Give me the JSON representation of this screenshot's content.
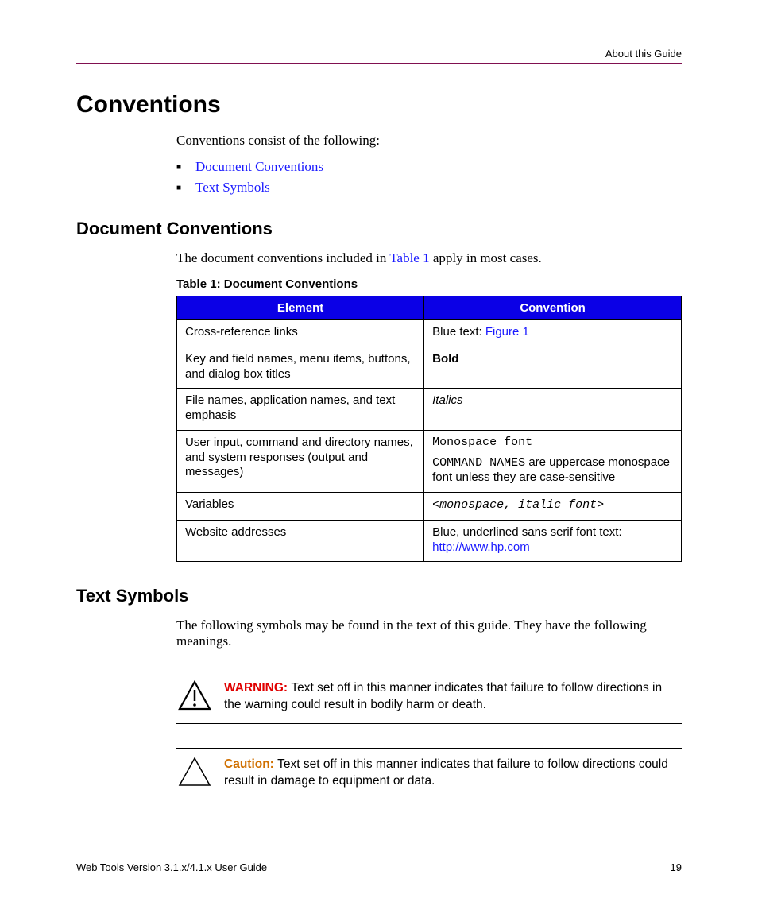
{
  "header": {
    "section": "About this Guide"
  },
  "h1": "Conventions",
  "intro": "Conventions consist of the following:",
  "links": {
    "doc_conv": "Document Conventions",
    "text_sym": "Text Symbols"
  },
  "doc_conv": {
    "heading": "Document Conventions",
    "intro_a": "The document conventions included in ",
    "intro_link": "Table 1",
    "intro_b": " apply in most cases.",
    "caption": "Table 1:  Document Conventions",
    "th1": "Element",
    "th2": "Convention",
    "rows": [
      {
        "el": "Cross-reference links",
        "conv_a": "Blue text: ",
        "conv_link": "Figure 1"
      },
      {
        "el": "Key and field names, menu items, buttons, and dialog box titles",
        "conv_bold": "Bold"
      },
      {
        "el": "File names, application names, and text emphasis",
        "conv_ital": "Italics"
      },
      {
        "el": "User input, command and directory names, and system responses (output and messages)",
        "conv_mono1": "Monospace font",
        "conv_mono2": "COMMAND NAMES",
        "conv_b": " are uppercase monospace font unless they are case-sensitive"
      },
      {
        "el": "Variables",
        "conv_monoital": "<monospace, italic font>"
      },
      {
        "el": "Website addresses",
        "conv_a": "Blue, underlined sans serif font text: ",
        "conv_url": "http://www.hp.com"
      }
    ]
  },
  "text_sym": {
    "heading": "Text Symbols",
    "intro": "The following symbols may be found in the text of this guide. They have the following meanings.",
    "warning": {
      "label": "WARNING:  ",
      "text": "Text set off in this manner indicates that failure to follow directions in the warning could result in bodily harm or death."
    },
    "caution": {
      "label": "Caution:  ",
      "text": "Text set off in this manner indicates that failure to follow directions could result in damage to equipment or data."
    }
  },
  "footer": {
    "left": "Web Tools Version 3.1.x/4.1.x User Guide",
    "right": "19"
  }
}
